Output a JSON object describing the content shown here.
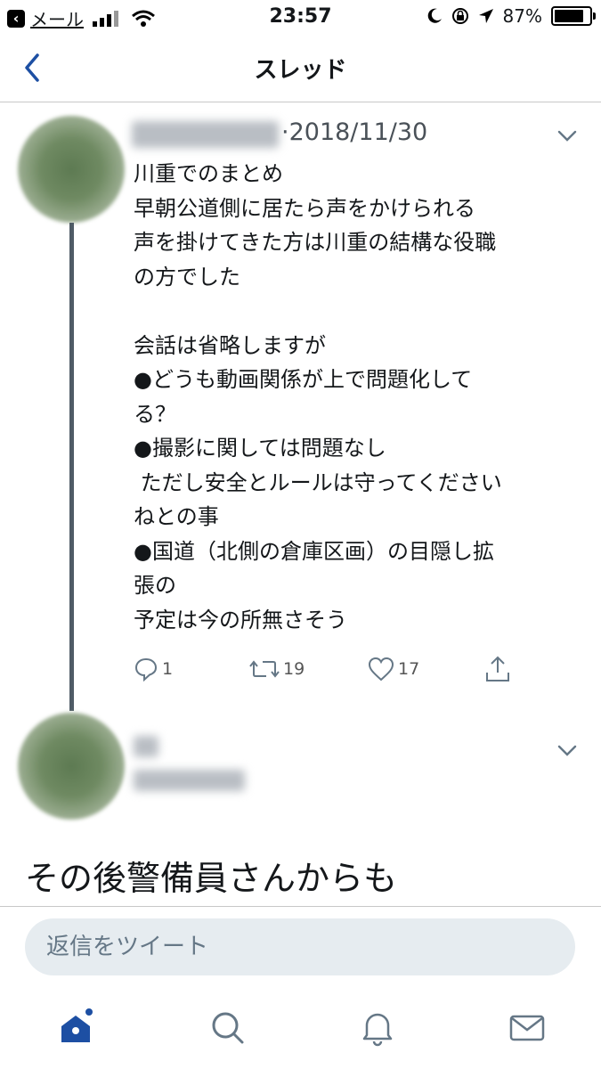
{
  "status_bar": {
    "back_app": "メール",
    "time": "23:57",
    "battery": "87%",
    "battery_level": 0.87
  },
  "header": {
    "title": "スレッド"
  },
  "tweets": [
    {
      "date": "·2018/11/30",
      "text": "川重でのまとめ\n早朝公道側に居たら声をかけられる\n声を掛けてきた方は川重の結構な役職\nの方でした\n\n会話は省略しますが\n●どうも動画関係が上で問題化して\nる？\n●撮影に関しては問題なし\n ただし安全とルールは守ってください\nねとの事\n●国道（北側の倉庫区画）の目隠し拡\n張の\n予定は今の所無さそう",
      "actions": {
        "reply_count": "1",
        "retweet_count": "19",
        "like_count": "17"
      }
    },
    {
      "text": "その後警備員さんからも"
    }
  ],
  "reply": {
    "placeholder": "返信をツイート"
  },
  "icons": {
    "accent": "#1d4fa3",
    "tabs": [
      "home-icon",
      "search-icon",
      "notifications-icon",
      "messages-icon"
    ]
  }
}
